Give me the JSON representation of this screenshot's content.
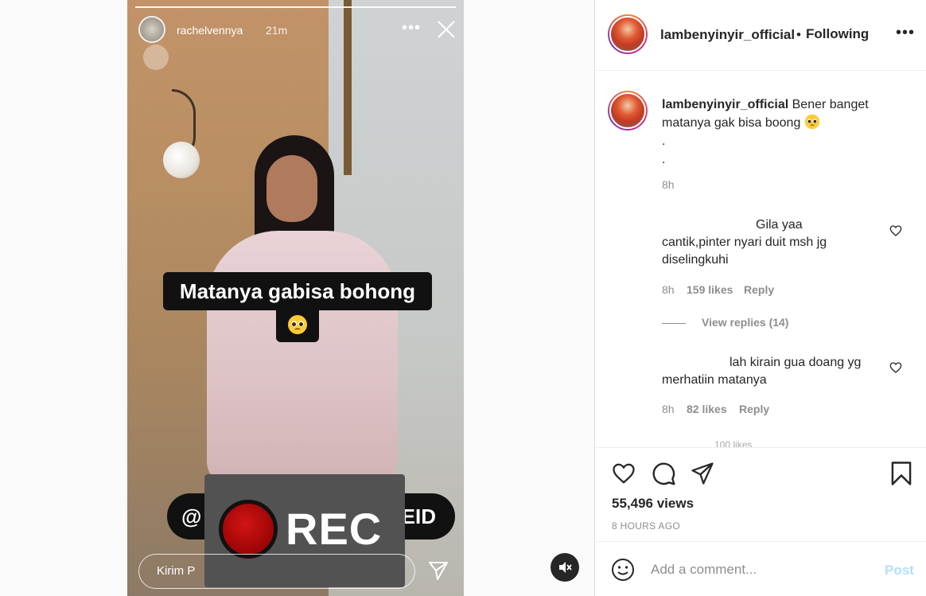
{
  "story": {
    "username": "rachelvennya",
    "time": "21m",
    "caption_text": "Matanya gabisa bohong",
    "caption_emoji": "🥺",
    "handle_start": "@",
    "handle_end": "EID",
    "rec_label": "REC",
    "reply_placeholder": "Kirim P"
  },
  "header": {
    "username": "lambenyinyir_official",
    "separator": "•",
    "follow_label": "Following"
  },
  "caption": {
    "username": "lambenyinyir_official",
    "text": " Bener banget matanya gak bisa boong",
    "emoji": "🥺",
    "dot1": ".",
    "dot2": ".",
    "time": "8h"
  },
  "comments": [
    {
      "line1": "Gila yaa",
      "line2": "cantik,pinter nyari duit msh jg diselingkuhi",
      "time": "8h",
      "likes": "159 likes",
      "reply": "Reply",
      "view_replies": "View replies (14)"
    },
    {
      "line1": "lah kirain gua doang yg",
      "line2": "merhatiin matanya",
      "time": "8h",
      "likes": "82 likes",
      "reply": "Reply"
    }
  ],
  "partial_comment": "100 likes",
  "stats": {
    "views": "55,496 views",
    "ago": "8 HOURS AGO"
  },
  "add_comment": {
    "placeholder": "Add a comment...",
    "post_label": "Post"
  },
  "colors": {
    "post_disabled": "#b2dffc",
    "muted_text": "#8e8e8e",
    "border": "#dbdbdb"
  },
  "icons": [
    "close-icon",
    "more-icon",
    "send-icon",
    "mute-icon",
    "heart-icon",
    "comment-icon",
    "share-icon",
    "bookmark-icon",
    "emoji-icon"
  ]
}
